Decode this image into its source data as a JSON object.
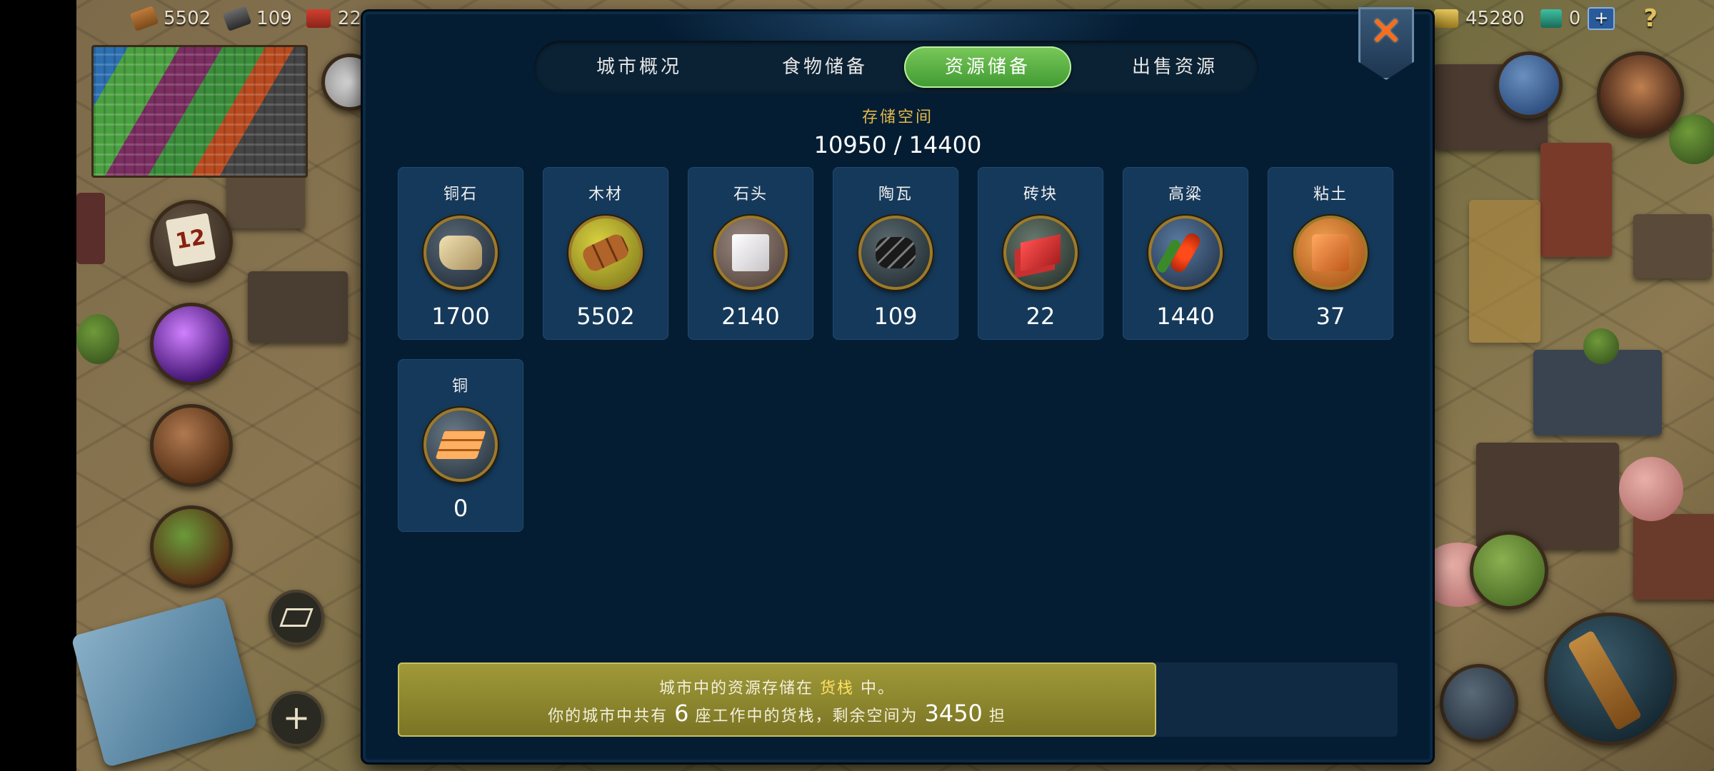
{
  "hud": {
    "top_left": [
      {
        "icon": "wood-icon",
        "value": "5502"
      },
      {
        "icon": "tile-icon",
        "value": "109"
      },
      {
        "icon": "brick-icon",
        "value": "22"
      }
    ],
    "top_right": {
      "gold": "45280",
      "gems": "0",
      "plus": "+",
      "help": "?"
    },
    "calendar_day": "12",
    "zoom_in": "+"
  },
  "panel": {
    "tabs": [
      {
        "label": "城市概况"
      },
      {
        "label": "食物储备"
      },
      {
        "label": "资源储备"
      },
      {
        "label": "出售资源"
      }
    ],
    "active_tab": 2,
    "close": "✕",
    "storage": {
      "title": "存储空间",
      "value": "10950 / 14400"
    },
    "resources": [
      {
        "name": "铜石",
        "qty": "1700",
        "icon": "copper-ore-icon"
      },
      {
        "name": "木材",
        "qty": "5502",
        "icon": "wood-logs-icon"
      },
      {
        "name": "石头",
        "qty": "2140",
        "icon": "stone-block-icon"
      },
      {
        "name": "陶瓦",
        "qty": "109",
        "icon": "roof-tile-icon"
      },
      {
        "name": "砖块",
        "qty": "22",
        "icon": "brick-icon"
      },
      {
        "name": "高粱",
        "qty": "1440",
        "icon": "sorghum-icon"
      },
      {
        "name": "粘土",
        "qty": "37",
        "icon": "clay-icon"
      },
      {
        "name": "铜",
        "qty": "0",
        "icon": "copper-ingot-icon"
      }
    ],
    "info": {
      "line1_prefix": "城市中的资源存储在",
      "line1_highlight": "货栈",
      "line1_suffix": "中。",
      "line2_prefix": "你的城市中共有",
      "warehouses": "6",
      "line2_mid": "座工作中的货栈，剩余空间为",
      "remaining": "3450",
      "line2_suffix": "担"
    }
  }
}
